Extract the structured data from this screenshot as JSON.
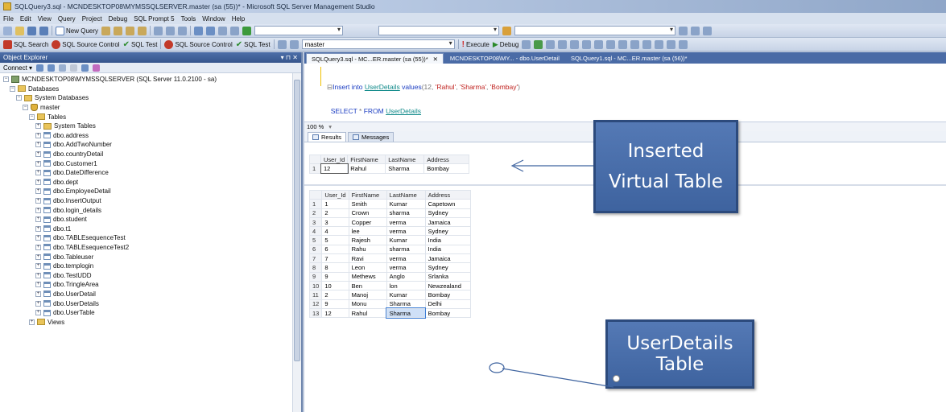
{
  "window": {
    "title": "SQLQuery3.sql - MCNDESKTOP08\\MYMSSQLSERVER.master (sa (55))* - Microsoft SQL Server Management Studio"
  },
  "menu": [
    "File",
    "Edit",
    "View",
    "Query",
    "Project",
    "Debug",
    "SQL Prompt 5",
    "Tools",
    "Window",
    "Help"
  ],
  "toolbar1": {
    "new_query": "New Query"
  },
  "toolbar2": {
    "items": [
      "SQL Search",
      "SQL Source Control",
      "SQL Test",
      "SQL Source Control",
      "SQL Test"
    ],
    "database": "master",
    "execute": "Execute",
    "debug": "Debug"
  },
  "object_explorer": {
    "title": "Object Explorer",
    "pin": "▾ ⊓ ✕",
    "connect": "Connect ▾",
    "server": "MCNDESKTOP08\\MYMSSQLSERVER (SQL Server 11.0.2100 - sa)",
    "nodes": [
      "Databases",
      "System Databases",
      "master",
      "Tables",
      "System Tables",
      "dbo.address",
      "dbo.AddTwoNumber",
      "dbo.countryDetail",
      "dbo.Customer1",
      "dbo.DateDifference",
      "dbo.dept",
      "dbo.EmployeeDetail",
      "dbo.InsertOutput",
      "dbo.login_details",
      "dbo.student",
      "dbo.t1",
      "dbo.TABLEsequenceTest",
      "dbo.TABLEsequenceTest2",
      "dbo.Tableuser",
      "dbo.templogin",
      "dbo.TestUDD",
      "dbo.TringleArea",
      "dbo.UserDetail",
      "dbo.UserDetails",
      "dbo.UserTable",
      "Views"
    ]
  },
  "tabs": [
    {
      "label": "SQLQuery3.sql - MC...ER.master (sa (55))*",
      "close": "✕"
    },
    {
      "label": "MCNDESKTOP08\\MY... - dbo.UserDetail"
    },
    {
      "label": "SQLQuery1.sql - MC...ER.master (sa (56))*"
    }
  ],
  "editor": {
    "line1": {
      "kw1": "Insert into",
      "obj": "UserDetails",
      "kw2": "values",
      "args": "(12, ",
      "s1": "'Rahul'",
      "c1": ", ",
      "s2": "'Sharma'",
      "c2": ", ",
      "s3": "'Bombay'",
      "end": ")"
    },
    "line2": {
      "kw": "SELECT",
      "star": " * ",
      "kw2": "FROM",
      "obj": "UserDetails"
    }
  },
  "zoom": "100 %",
  "results_tabs": [
    "Results",
    "Messages"
  ],
  "columns": [
    "User_Id",
    "FirstName",
    "LastName",
    "Address"
  ],
  "grid1": [
    {
      "n": "1",
      "uid": "12",
      "fn": "Rahul",
      "ln": "Sharma",
      "ad": "Bombay"
    }
  ],
  "grid2": [
    {
      "n": "1",
      "uid": "1",
      "fn": "Smith",
      "ln": "Kumar",
      "ad": "Capetown"
    },
    {
      "n": "2",
      "uid": "2",
      "fn": "Crown",
      "ln": "sharma",
      "ad": "Sydney"
    },
    {
      "n": "3",
      "uid": "3",
      "fn": "Copper",
      "ln": "verma",
      "ad": "Jamaica"
    },
    {
      "n": "4",
      "uid": "4",
      "fn": "lee",
      "ln": "verma",
      "ad": "Sydney"
    },
    {
      "n": "5",
      "uid": "5",
      "fn": "Rajesh",
      "ln": "Kumar",
      "ad": "India"
    },
    {
      "n": "6",
      "uid": "6",
      "fn": "Rahu",
      "ln": "sharma",
      "ad": "India"
    },
    {
      "n": "7",
      "uid": "7",
      "fn": "Ravi",
      "ln": "verma",
      "ad": "Jamaica"
    },
    {
      "n": "8",
      "uid": "8",
      "fn": "Leon",
      "ln": "verma",
      "ad": "Sydney"
    },
    {
      "n": "9",
      "uid": "9",
      "fn": "Methews",
      "ln": "Anglo",
      "ad": "Srlanka"
    },
    {
      "n": "10",
      "uid": "10",
      "fn": "Ben",
      "ln": "lon",
      "ad": "Newzealand"
    },
    {
      "n": "11",
      "uid": "2",
      "fn": "Manoj",
      "ln": "Kumar",
      "ad": "Bombay"
    },
    {
      "n": "12",
      "uid": "9",
      "fn": "Monu",
      "ln": "Sharma",
      "ad": "Delhi"
    },
    {
      "n": "13",
      "uid": "12",
      "fn": "Rahul",
      "ln": "Sharma",
      "ad": "Bombay"
    }
  ],
  "callouts": {
    "inserted": "Inserted Virtual Table",
    "userdetails": "UserDetails Table"
  },
  "colors": {
    "callout": "#4a6fae",
    "accent": "#36558c"
  }
}
